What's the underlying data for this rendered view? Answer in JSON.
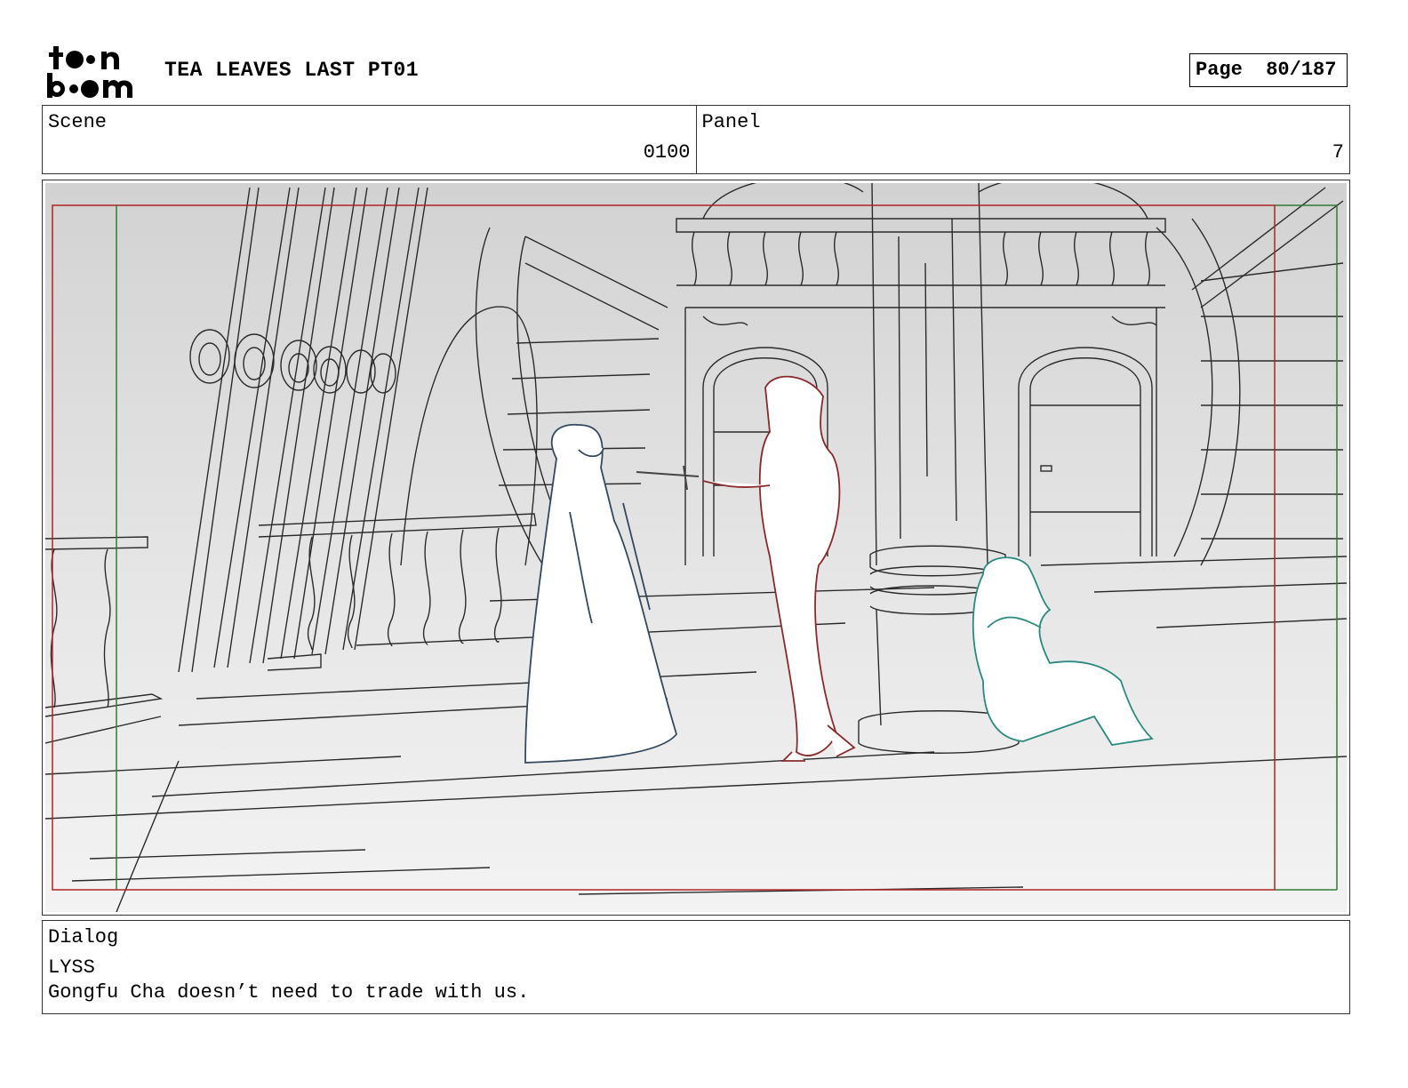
{
  "header": {
    "logo_text": "toon boom",
    "project_title": "TEA LEAVES LAST PT01",
    "page_label": "Page",
    "page_value": "80/187"
  },
  "scene": {
    "label": "Scene",
    "value": "0100"
  },
  "panel": {
    "label": "Panel",
    "value": "7"
  },
  "dialog": {
    "label": "Dialog",
    "speaker": "LYSS",
    "line": "Gongfu Cha doesn’t need to trade with us."
  },
  "artwork": {
    "icon": "storyboard-sketch-ship-deck",
    "colors": {
      "title_safe": "#b22222",
      "action_safe": "#2e7d32",
      "character_left": "#34495e",
      "character_center": "#8b2a2a",
      "character_right": "#2a8a80"
    }
  }
}
